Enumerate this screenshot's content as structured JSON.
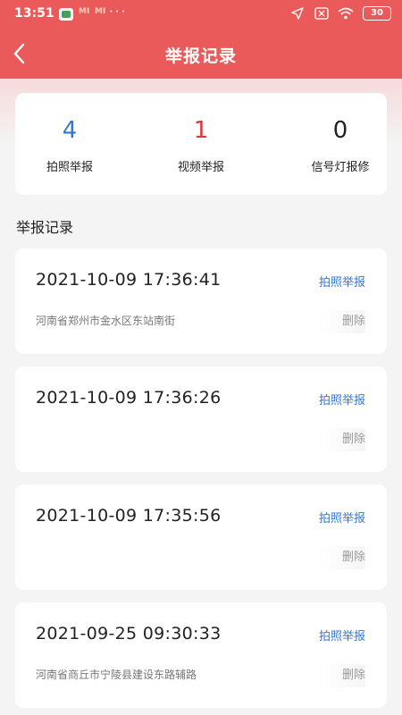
{
  "status_bar": {
    "time": "13:51",
    "battery": "30",
    "icons": [
      "app-green-icon",
      "mi-icon",
      "mi-icon",
      "more-dots-icon",
      "location-arrow-icon",
      "sim-x-icon",
      "wifi-icon",
      "battery-icon"
    ]
  },
  "nav": {
    "title": "举报记录",
    "back_icon": "chevron-left-icon"
  },
  "stats": [
    {
      "value": "4",
      "label": "拍照举报"
    },
    {
      "value": "1",
      "label": "视频举报"
    },
    {
      "value": "0",
      "label": "信号灯报修"
    }
  ],
  "section_title": "举报记录",
  "records": [
    {
      "time": "2021-10-09 17:36:41",
      "type": "拍照举报",
      "address": "河南省郑州市金水区东站南街",
      "delete": "删除"
    },
    {
      "time": "2021-10-09 17:36:26",
      "type": "拍照举报",
      "address": "",
      "delete": "删除"
    },
    {
      "time": "2021-10-09 17:35:56",
      "type": "拍照举报",
      "address": "",
      "delete": "删除"
    },
    {
      "time": "2021-09-25 09:30:33",
      "type": "拍照举报",
      "address": "河南省商丘市宁陵县建设东路辅路",
      "delete": "删除"
    }
  ],
  "colors": {
    "header": "#ea5a5a",
    "blue": "#3575d5",
    "red": "#d8393b"
  }
}
